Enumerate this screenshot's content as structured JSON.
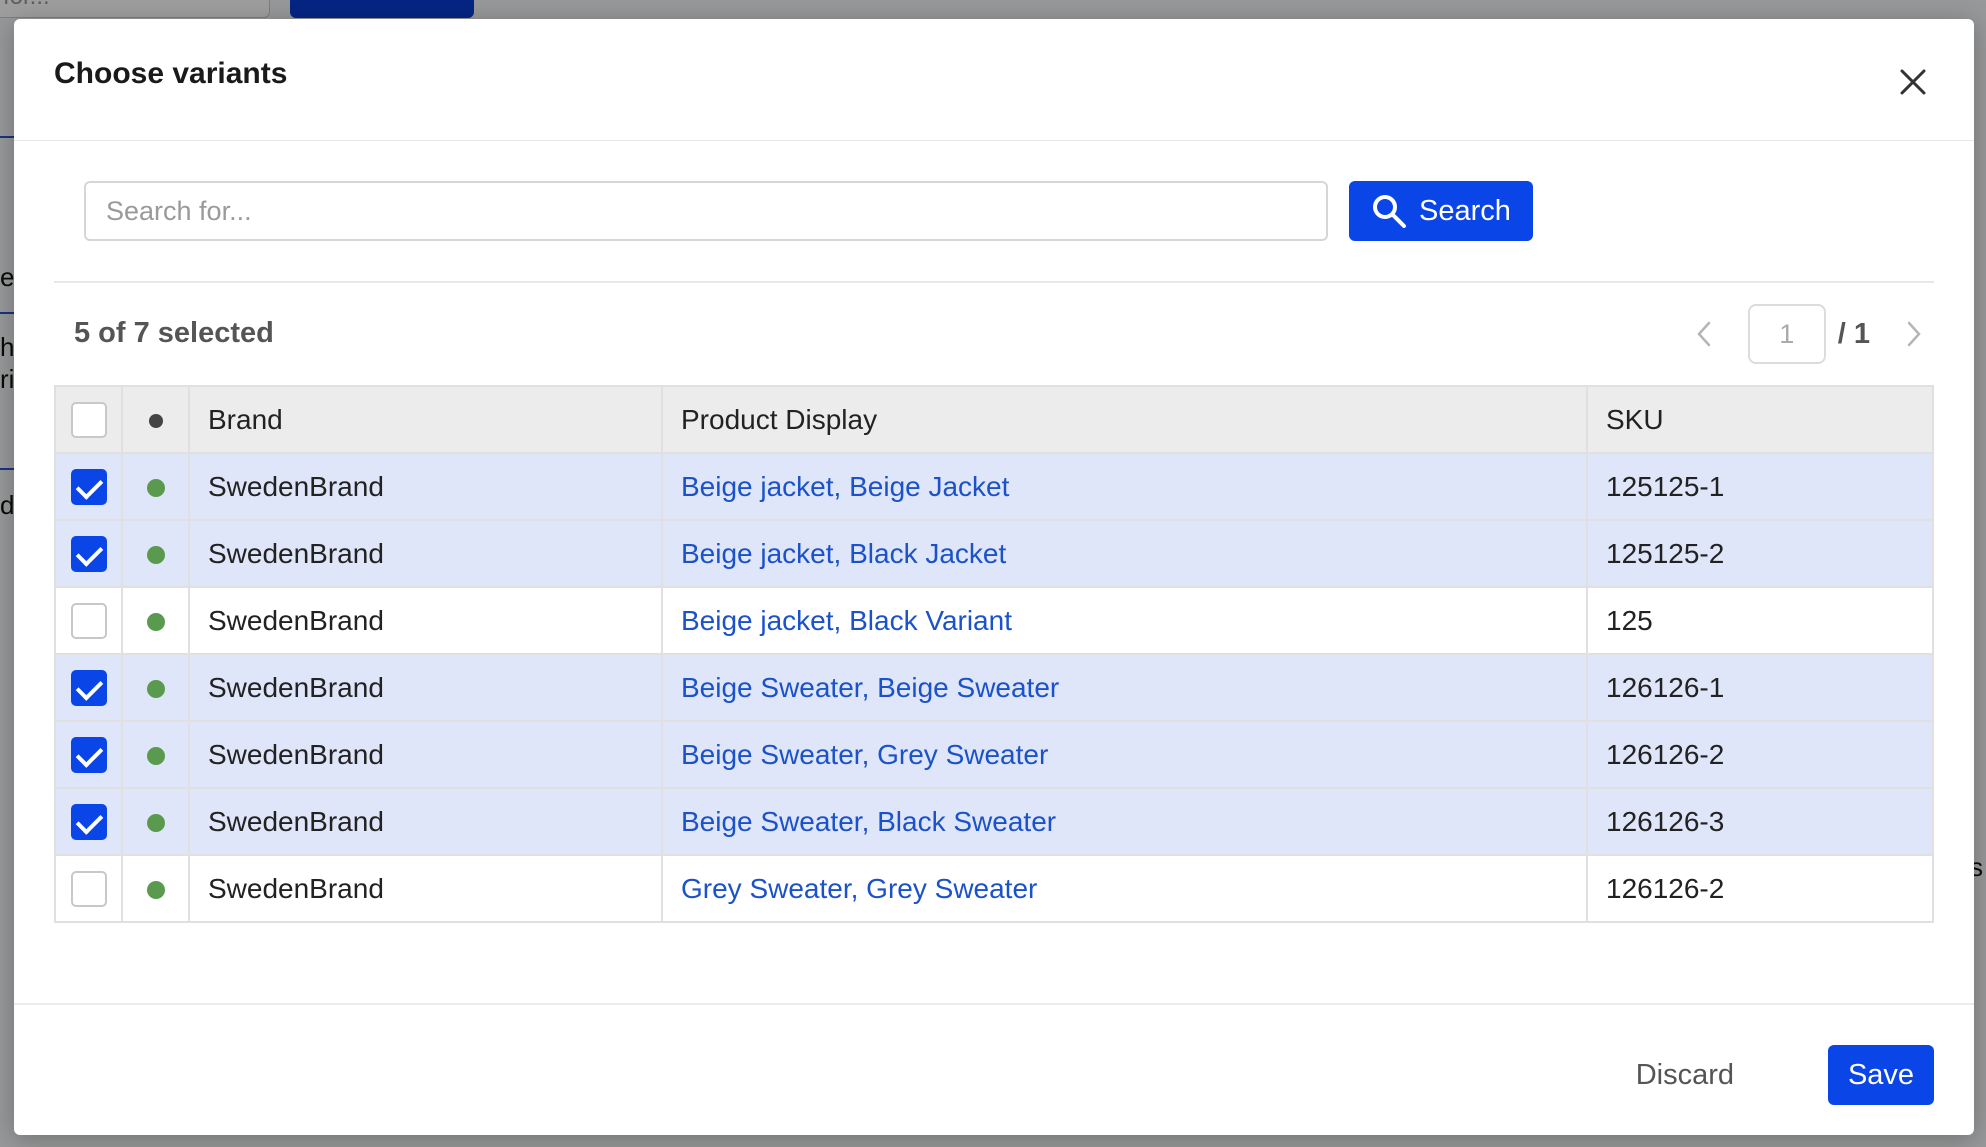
{
  "background": {
    "input_fragment": "for...",
    "text_fragments": [
      "e",
      "h",
      "ri",
      "d",
      "s"
    ]
  },
  "modal": {
    "title": "Choose variants"
  },
  "search": {
    "placeholder": "Search for...",
    "value": "",
    "button_label": "Search"
  },
  "selection": {
    "summary": "5 of 7 selected"
  },
  "pagination": {
    "current_page": "1",
    "total_label": "/ 1"
  },
  "table": {
    "columns": [
      "Brand",
      "Product Display",
      "SKU"
    ],
    "rows": [
      {
        "selected": true,
        "status_color": "#5a9a4e",
        "brand": "SwedenBrand",
        "product": "Beige jacket, Beige Jacket",
        "sku": "125125-1"
      },
      {
        "selected": true,
        "status_color": "#5a9a4e",
        "brand": "SwedenBrand",
        "product": "Beige jacket, Black Jacket",
        "sku": "125125-2"
      },
      {
        "selected": false,
        "status_color": "#5a9a4e",
        "brand": "SwedenBrand",
        "product": "Beige jacket, Black Variant",
        "sku": "125"
      },
      {
        "selected": true,
        "status_color": "#5a9a4e",
        "brand": "SwedenBrand",
        "product": "Beige Sweater, Beige Sweater",
        "sku": "126126-1"
      },
      {
        "selected": true,
        "status_color": "#5a9a4e",
        "brand": "SwedenBrand",
        "product": "Beige Sweater, Grey Sweater",
        "sku": "126126-2"
      },
      {
        "selected": true,
        "status_color": "#5a9a4e",
        "brand": "SwedenBrand",
        "product": "Beige Sweater, Black Sweater",
        "sku": "126126-3"
      },
      {
        "selected": false,
        "status_color": "#5a9a4e",
        "brand": "SwedenBrand",
        "product": "Grey Sweater, Grey Sweater",
        "sku": "126126-2"
      }
    ]
  },
  "footer": {
    "discard_label": "Discard",
    "save_label": "Save"
  },
  "colors": {
    "accent": "#0a45e8",
    "selected_row": "#dfe6f9",
    "link": "#1b52c9",
    "status_active": "#5a9a4e"
  },
  "icons": {
    "close": "close-icon",
    "search": "search-icon",
    "prev": "chevron-left-icon",
    "next": "chevron-right-icon",
    "status_header": "status-dot-icon"
  }
}
